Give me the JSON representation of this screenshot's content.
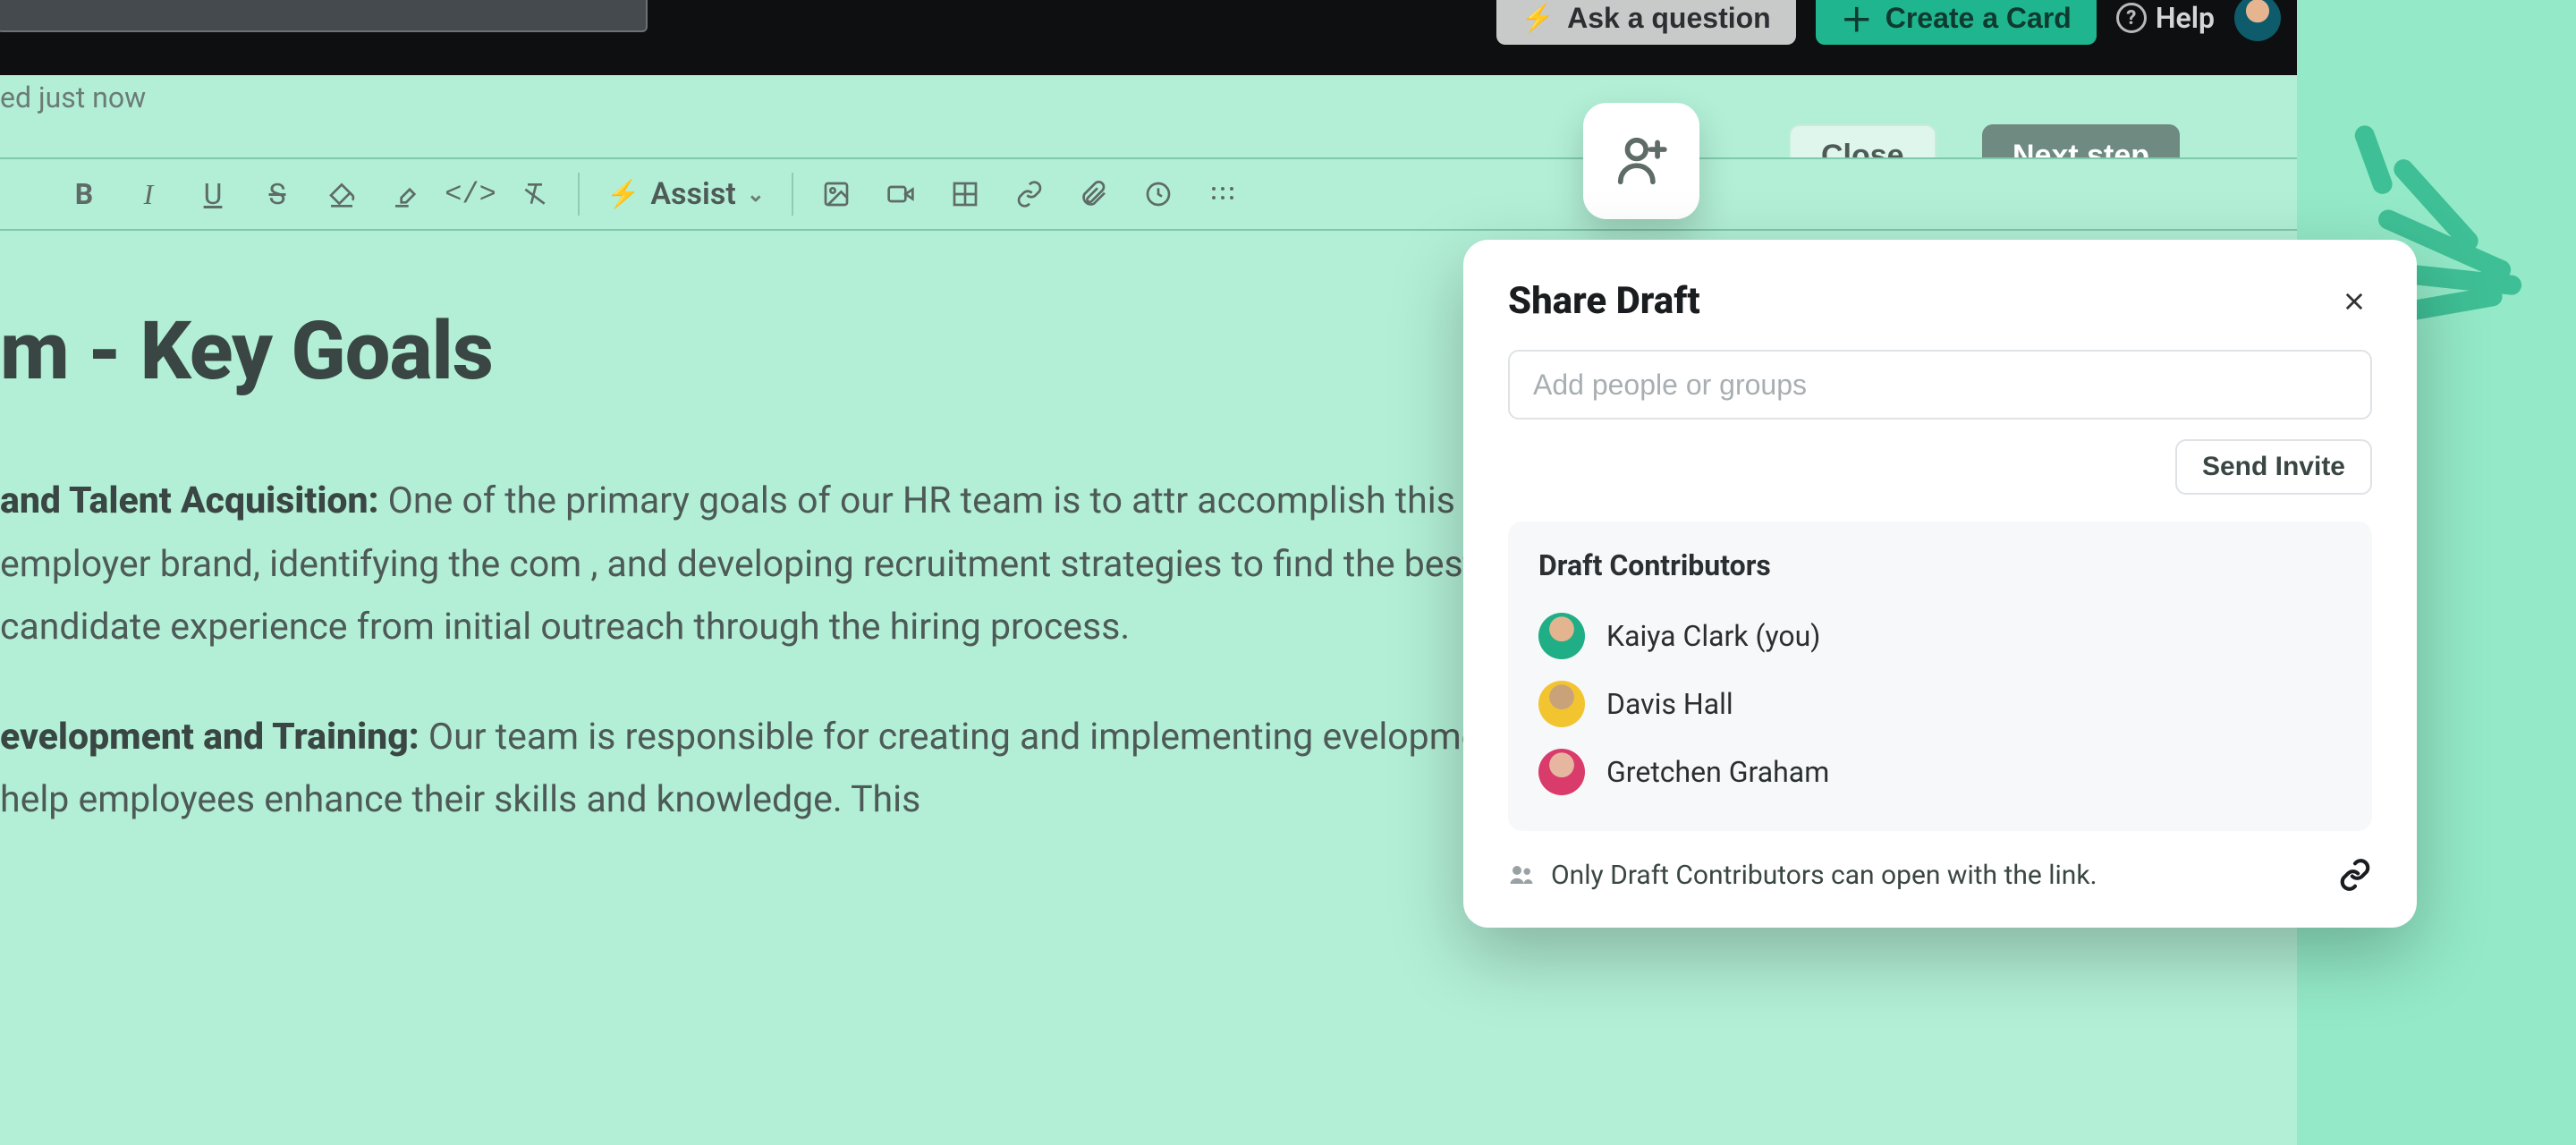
{
  "topbar": {
    "ask_label": "Ask a question",
    "create_label": "Create a Card",
    "help_label": "Help"
  },
  "editor": {
    "saved_status": "ed just now",
    "assist_label": "Assist",
    "close_label": "Close",
    "next_label": "Next step"
  },
  "document": {
    "title": "m - Key Goals",
    "p1_strong": "and Talent Acquisition:",
    "p1_rest": " One of the primary goals of our HR team is to attr  accomplish this by creating a strong employer brand, identifying the com , and developing recruitment strategies to find the best candidates. Our t candidate experience from initial outreach through the hiring process.",
    "p2_strong": "evelopment and Training:",
    "p2_rest": " Our team is responsible for creating and implementing evelopment programs that help employees enhance their skills and knowledge. This"
  },
  "share": {
    "title": "Share Draft",
    "input_placeholder": "Add people or groups",
    "send_label": "Send Invite",
    "contributors_title": "Draft Contributors",
    "contributors": [
      {
        "name": "Kaiya Clark (you)"
      },
      {
        "name": "Davis Hall"
      },
      {
        "name": "Gretchen Graham"
      }
    ],
    "link_text": "Only Draft Contributors can open with the link."
  }
}
